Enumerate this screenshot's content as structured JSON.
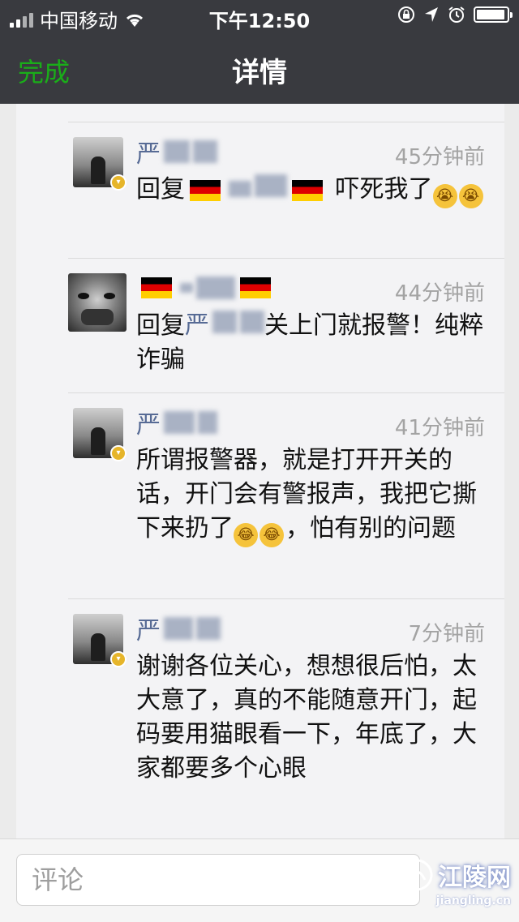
{
  "status_bar": {
    "carrier": "中国移动",
    "time": "下午12:50"
  },
  "nav": {
    "done_label": "完成",
    "title": "详情"
  },
  "comments": [
    {
      "name": "严",
      "time": "45分钟前",
      "reply_prefix": "回复",
      "text": "吓死我了"
    },
    {
      "name": "",
      "time": "44分钟前",
      "reply_prefix": "回复",
      "reply_name": "严",
      "text": "关上门就报警！纯粹诈骗"
    },
    {
      "name": "严",
      "time": "41分钟前",
      "text_part1": "所谓报警器，就是打开开关的话，开门会有警报声，我把它撕下来扔了",
      "text_part2": "，怕有别的问题"
    },
    {
      "name": "严",
      "time": "7分钟前",
      "text": "谢谢各位关心，想想很后怕，太大意了，真的不能随意开门，起码要用猫眼看一下，年底了，大家都要多个心眼"
    }
  ],
  "input": {
    "placeholder": "评论"
  },
  "watermark": {
    "brand": "江陵网",
    "url": "jiangling.cn"
  },
  "colors": {
    "header_bg": "#393a3f",
    "accent_green": "#1aad19",
    "link_blue": "#576b95"
  }
}
